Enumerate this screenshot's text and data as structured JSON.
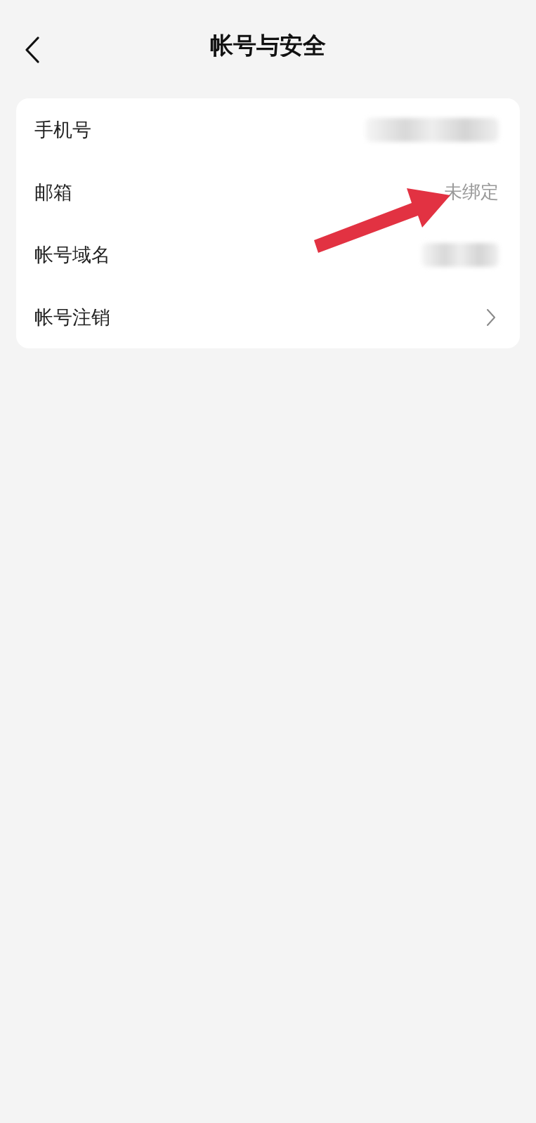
{
  "header": {
    "title": "帐号与安全"
  },
  "rows": [
    {
      "label": "手机号",
      "kind": "blurred"
    },
    {
      "label": "邮箱",
      "kind": "value",
      "value": "未绑定"
    },
    {
      "label": "帐号域名",
      "kind": "blurred"
    },
    {
      "label": "帐号注销",
      "kind": "link"
    }
  ]
}
